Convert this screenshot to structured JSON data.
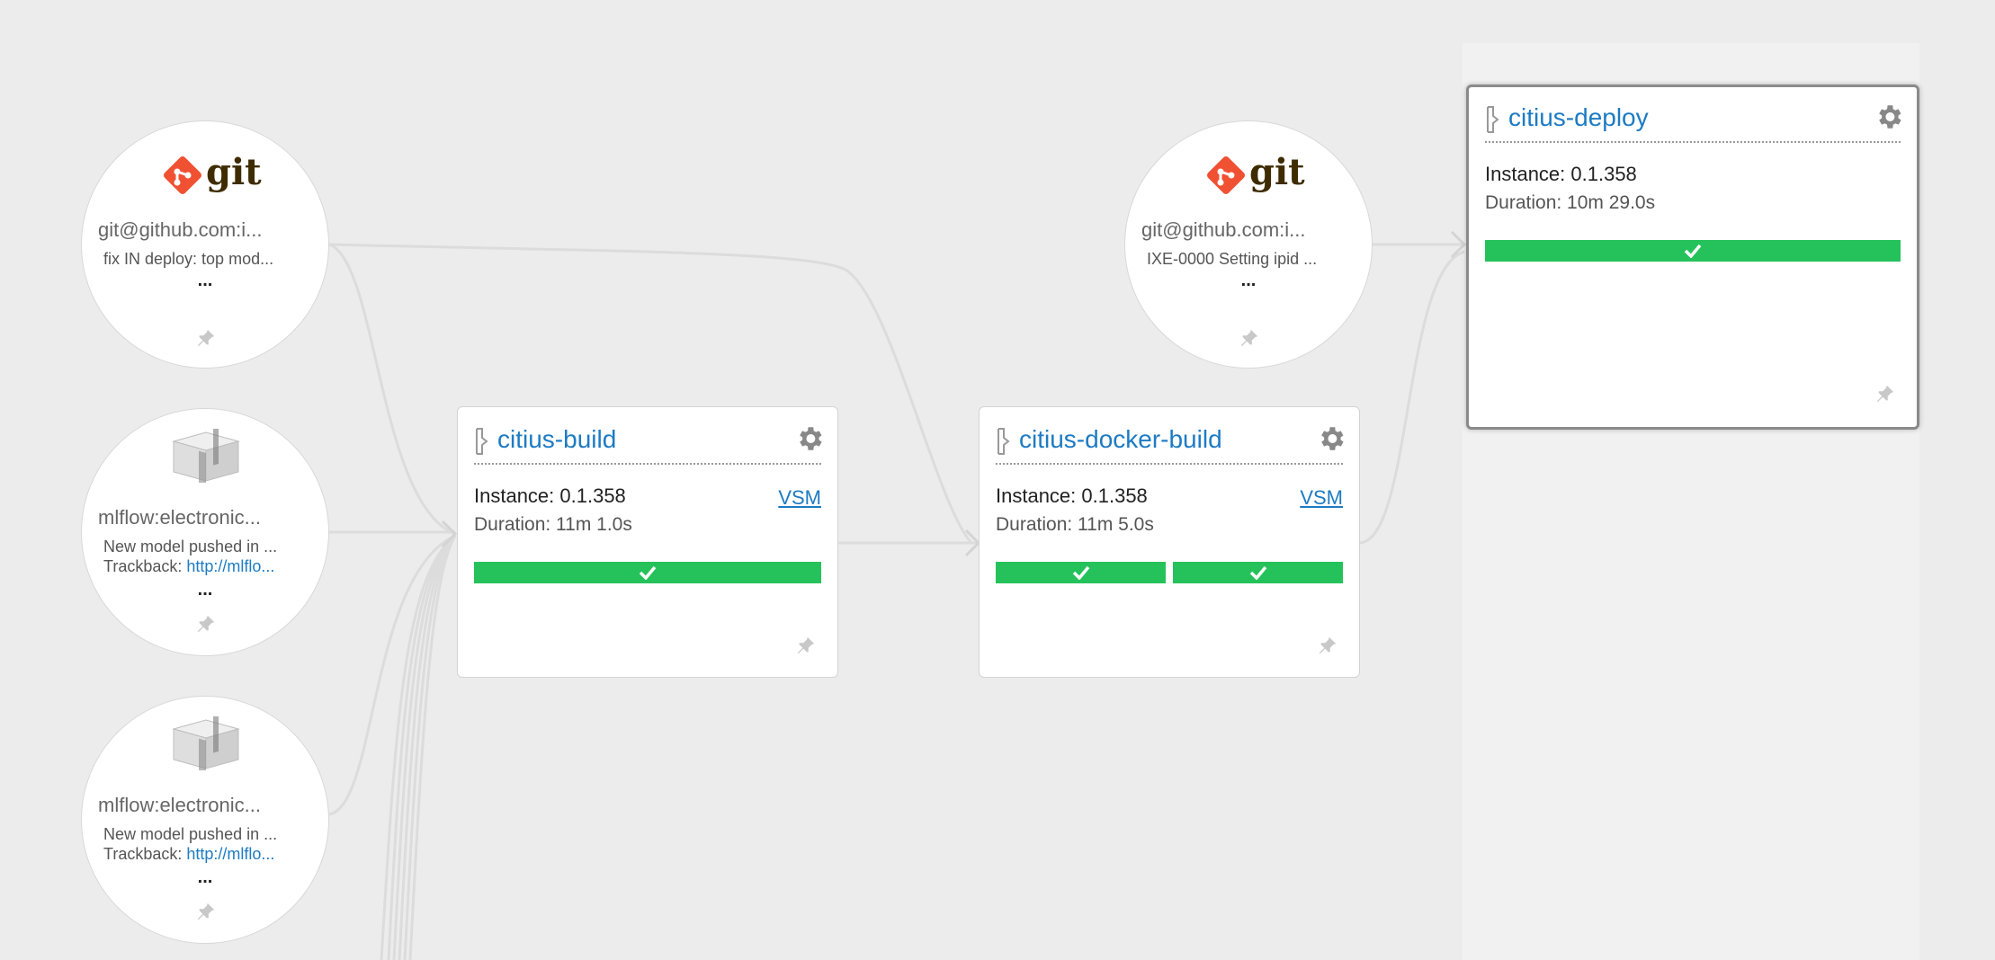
{
  "colors": {
    "background": "#ececec",
    "link": "#1d7bc3",
    "stage_passed": "#25c25b",
    "edge": "#dcdcdc"
  },
  "materials": [
    {
      "type": "git",
      "logo_label": "git",
      "icon": "git-logo-icon",
      "name": "git@github.com:i...",
      "desc": "fix IN deploy: top mod...",
      "more": "..."
    },
    {
      "type": "package",
      "icon": "package-box-icon",
      "name": "mlflow:electronic...",
      "desc": "New model pushed in ...",
      "trackback_label": "Trackback:",
      "trackback_link": "http://mlflo...",
      "more": "..."
    },
    {
      "type": "package",
      "icon": "package-box-icon",
      "name": "mlflow:electronic...",
      "desc": "New model pushed in ...",
      "trackback_label": "Trackback:",
      "trackback_link": "http://mlflo...",
      "more": "..."
    },
    {
      "type": "git",
      "logo_label": "git",
      "icon": "git-logo-icon",
      "name": "git@github.com:i...",
      "desc": "IXE-0000 Setting ipid ...",
      "more": "..."
    }
  ],
  "pipelines": [
    {
      "name": "citius-build",
      "instance": "Instance: 0.1.358",
      "duration": "Duration: 11m 1.0s",
      "vsm": "VSM",
      "stages": [
        "passed"
      ]
    },
    {
      "name": "citius-docker-build",
      "instance": "Instance: 0.1.358",
      "duration": "Duration: 11m 5.0s",
      "vsm": "VSM",
      "stages": [
        "passed",
        "passed"
      ]
    },
    {
      "name": "citius-deploy",
      "instance": "Instance: 0.1.358",
      "duration": "Duration: 10m 29.0s",
      "stages": [
        "passed"
      ],
      "selected": true
    }
  ]
}
